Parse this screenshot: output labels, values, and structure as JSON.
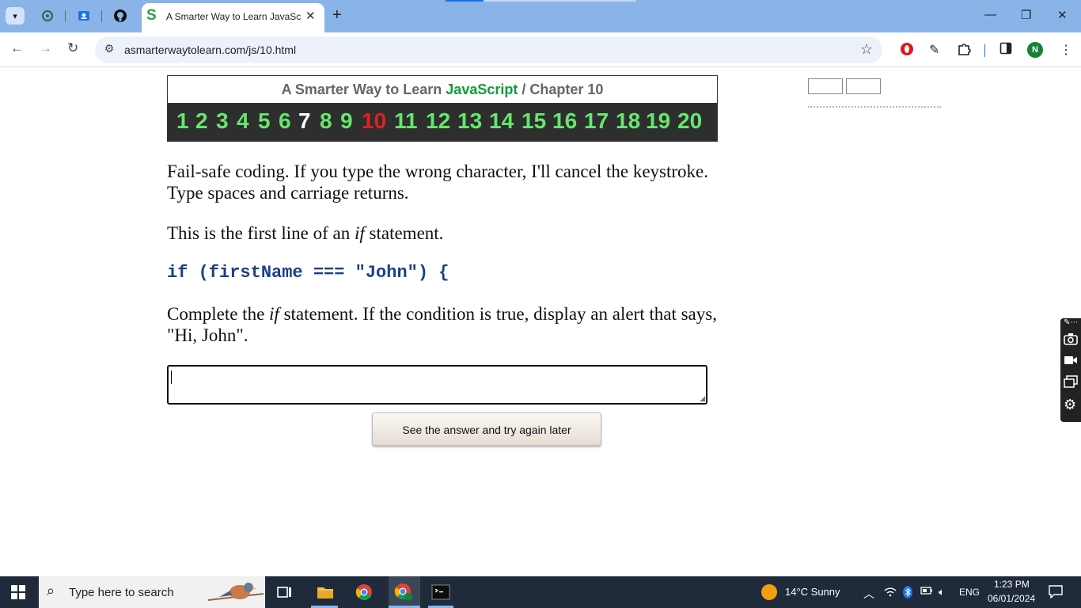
{
  "browser": {
    "tab_title": "A Smarter Way to Learn JavaScript",
    "tab_favicon": "S",
    "url": "asmarterwaytolearn.com/js/10.html",
    "profile_initial": "N"
  },
  "page": {
    "header": {
      "title_prefix": "A Smarter Way to Learn ",
      "title_js": "JavaScript",
      "title_sep": " / ",
      "title_chapter": "Chapter 10"
    },
    "chapters": [
      "1",
      "2",
      "3",
      "4",
      "5",
      "6",
      "7",
      "8",
      "9",
      "10",
      "11",
      "12",
      "13",
      "14",
      "15",
      "16",
      "17",
      "18",
      "19",
      "20"
    ],
    "chapter_state": {
      "seen": "7",
      "current": "10"
    },
    "para1_line1": "Fail-safe coding. If you type the wrong character, I'll cancel the keystroke.",
    "para1_line2": "Type spaces and carriage returns.",
    "para2_pre": "This is the first line of an ",
    "para2_em": "if",
    "para2_post": " statement.",
    "code_line": "if (firstName === \"John\") {",
    "para3_pre": "Complete the ",
    "para3_em": "if",
    "para3_post": " statement. If the condition is true, display an alert that says,",
    "para3_line2": "\"Hi, John\".",
    "answer_value": "",
    "see_answer_label": "See the answer and try again later"
  },
  "taskbar": {
    "search_placeholder": "Type here to search",
    "weather": "14°C  Sunny",
    "lang": "ENG",
    "time": "1:23 PM",
    "date": "06/01/2024"
  },
  "colors": {
    "chapter_default": "#66e66e",
    "chapter_current": "#e02020",
    "chapter_seen": "#ffffff",
    "javascript_label": "#119a3a",
    "code": "#1c3f8a"
  }
}
